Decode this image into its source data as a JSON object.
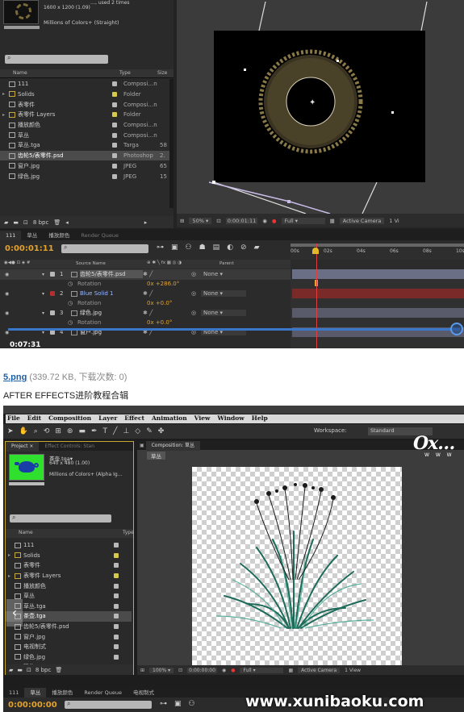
{
  "shot1": {
    "file_info": {
      "dims": "1600 x 1200 (1.09)",
      "colors": "Millions of Colors+ (Straight)",
      "top": "…, used 2 times"
    },
    "project_cols": {
      "name": "Name",
      "type": "Type",
      "size": "Size"
    },
    "project_items": [
      {
        "name": "111",
        "type": "Composi…n",
        "size": "",
        "color": "#b8b8b8",
        "kind": "comp"
      },
      {
        "name": "Solids",
        "type": "Folder",
        "size": "",
        "color": "#d6c94a",
        "kind": "folder"
      },
      {
        "name": "表零件",
        "type": "Composi…n",
        "size": "",
        "color": "#b8b8b8",
        "kind": "comp"
      },
      {
        "name": "表零件 Layers",
        "type": "Folder",
        "size": "",
        "color": "#d6c94a",
        "kind": "folder"
      },
      {
        "name": "播放颜色",
        "type": "Composi…n",
        "size": "",
        "color": "#b8b8b8",
        "kind": "comp"
      },
      {
        "name": "草丛",
        "type": "Composi…n",
        "size": "",
        "color": "#b8b8b8",
        "kind": "comp"
      },
      {
        "name": "草丛.tga",
        "type": "Targa",
        "size": "58",
        "color": "#b8b8b8",
        "kind": "file"
      },
      {
        "name": "齿轮5/表零件.psd",
        "type": "Photoshop",
        "size": "2.",
        "color": "#b8b8b8",
        "kind": "file",
        "selected": true
      },
      {
        "name": "窗户.jpg",
        "type": "JPEG",
        "size": "65",
        "color": "#b8b8b8",
        "kind": "file"
      },
      {
        "name": "绿色.jpg",
        "type": "JPEG",
        "size": "15",
        "color": "#b8b8b8",
        "kind": "file"
      }
    ],
    "bpc": "8 bpc",
    "zoom": "50%",
    "timecode": "0:00:01:11",
    "resolution": "Full",
    "camera": "Active Camera",
    "view": "1 Vi",
    "timeline_tabs": [
      "111",
      "草丛",
      "播放颜色",
      "Render Queue"
    ],
    "timecode_big": "0:00:01:11",
    "layer_cols": {
      "source": "Source Name",
      "parent": "Parent"
    },
    "layers": [
      {
        "num": "1",
        "name": "齿轮5/表零件.psd",
        "prop": "Rotation",
        "value": "0x +286.0°",
        "parent": "None",
        "color": "#b8b8b8"
      },
      {
        "num": "2",
        "name": "Blue Solid 1",
        "prop": "Rotation",
        "value": "0x +0.0°",
        "parent": "None",
        "color": "#b03030"
      },
      {
        "num": "3",
        "name": "绿色.jpg",
        "prop": "Rotation",
        "value": "0x +0.0°",
        "parent": "None",
        "color": "#b8b8b8"
      },
      {
        "num": "4",
        "name": "窗户.jpg",
        "prop": "",
        "value": "",
        "parent": "None",
        "color": "#b8b8b8"
      }
    ],
    "ruler": [
      "00s",
      "02s",
      "04s",
      "06s",
      "08s",
      "10s"
    ],
    "playtime": "0:07:31"
  },
  "caption": {
    "filename": "5.png",
    "meta": "(339.72 KB, 下载次数: 0)",
    "title": "AFTER EFFECTS进阶教程合辑"
  },
  "shot2": {
    "menu": [
      "File",
      "Edit",
      "Composition",
      "Layer",
      "Effect",
      "Animation",
      "View",
      "Window",
      "Help"
    ],
    "workspace_label": "Workspace:",
    "workspace_value": "Standard",
    "panel_tabs": [
      "Project ×",
      "Effect Controls: Stan"
    ],
    "comp_tab": "Composition: 草丛",
    "comp_sub": "草丛",
    "file_info": {
      "name": "茶壶.tga▾",
      "dims": "640 x 480 (1.00)",
      "colors": "Millions of Colors+ (Alpha Ig…"
    },
    "project_cols": {
      "name": "Name",
      "type": "Type"
    },
    "project_items": [
      {
        "name": "111",
        "kind": "comp"
      },
      {
        "name": "Solids",
        "kind": "folder"
      },
      {
        "name": "表零件",
        "kind": "comp"
      },
      {
        "name": "表零件 Layers",
        "kind": "folder"
      },
      {
        "name": "播放颜色",
        "kind": "comp"
      },
      {
        "name": "草丛",
        "kind": "comp"
      },
      {
        "name": "草丛.tga",
        "kind": "file"
      },
      {
        "name": "茶壶.tga",
        "kind": "file",
        "selected": true
      },
      {
        "name": "齿轮5/表零件.psd",
        "kind": "file"
      },
      {
        "name": "窗户.jpg",
        "kind": "file"
      },
      {
        "name": "电视制式",
        "kind": "comp"
      },
      {
        "name": "绿色.jpg",
        "kind": "file"
      },
      {
        "name": "码头.mov",
        "kind": "file"
      }
    ],
    "bpc": "8 bpc",
    "zoom": "100%",
    "timecode": "0:00:00:00",
    "resolution": "Full",
    "camera": "Active Camera",
    "view": "1 View",
    "timeline_tabs": [
      "111",
      "草丛",
      "播放颜色",
      "Render Queue",
      "电视制式"
    ],
    "timecode_big": "0:00:00:00",
    "watermark": "www.xunibaoku.com",
    "logo_sub": "W W W"
  }
}
